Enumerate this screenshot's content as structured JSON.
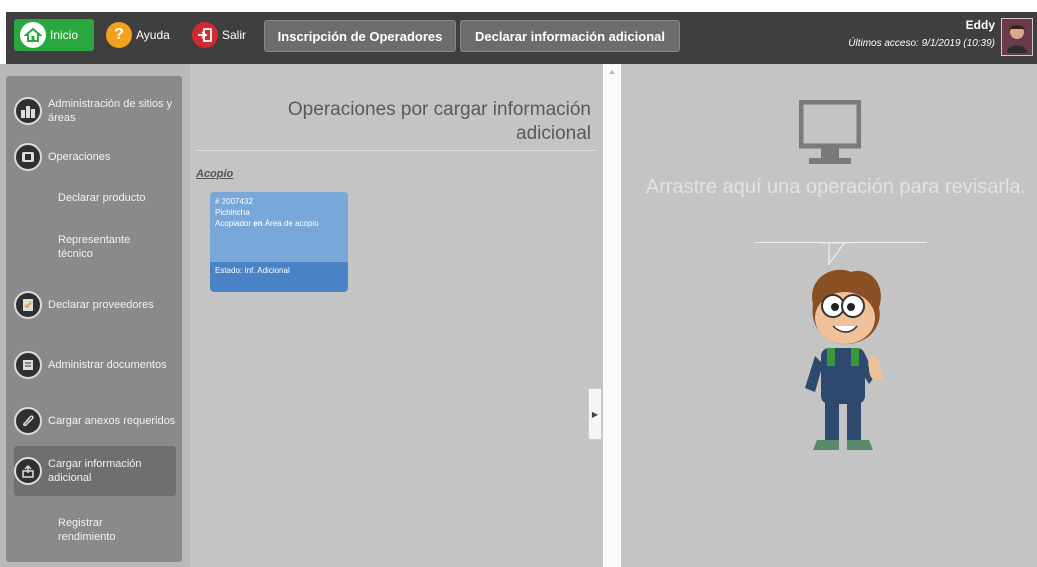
{
  "topbar": {
    "inicio_label": "Inicio",
    "ayuda_label": "Ayuda",
    "salir_label": "Salir",
    "tab_inscripcion": "Inscripción de Operadores",
    "tab_declarar_info": "Declarar información adicional",
    "user_name": "Eddy",
    "last_access": "Últimos acceso: 9/1/2019 (10:39)"
  },
  "sidebar": {
    "items": [
      {
        "label": "Administración de sitios y áreas",
        "icon": "buildings-icon"
      },
      {
        "label": "Operaciones",
        "icon": "operations-icon"
      },
      {
        "label": "Declarar producto"
      },
      {
        "label": "Representante técnico"
      },
      {
        "label": "Declarar proveedores",
        "icon": "suppliers-icon"
      },
      {
        "label": "Administrar documentos",
        "icon": "documents-icon"
      },
      {
        "label": "Cargar anexos requeridos",
        "icon": "paperclip-icon"
      },
      {
        "label": "Cargar información adicional",
        "icon": "upload-info-icon"
      },
      {
        "label": "Registrar rendimiento"
      }
    ]
  },
  "middle": {
    "title": "Operaciones por cargar información adicional",
    "group_label": "Acopio",
    "card": {
      "number": "# 2007432",
      "province": "Pichincha",
      "role_prefix": "Acopiador",
      "role_connector": "en",
      "role_suffix": "Área de acopio",
      "status": "Estado: Inf. Adicional"
    }
  },
  "right": {
    "drop_text": "Arrastre aquí una operación para revisarla."
  },
  "colors": {
    "topbar": "#3f3f3f",
    "inicio_green": "#2aa83f",
    "ayuda_orange": "#f3a21b",
    "salir_red": "#d12a2f",
    "card_light": "#78a8d8",
    "card_dark": "#4a82c6",
    "panel_gray": "#c4c4c4"
  }
}
